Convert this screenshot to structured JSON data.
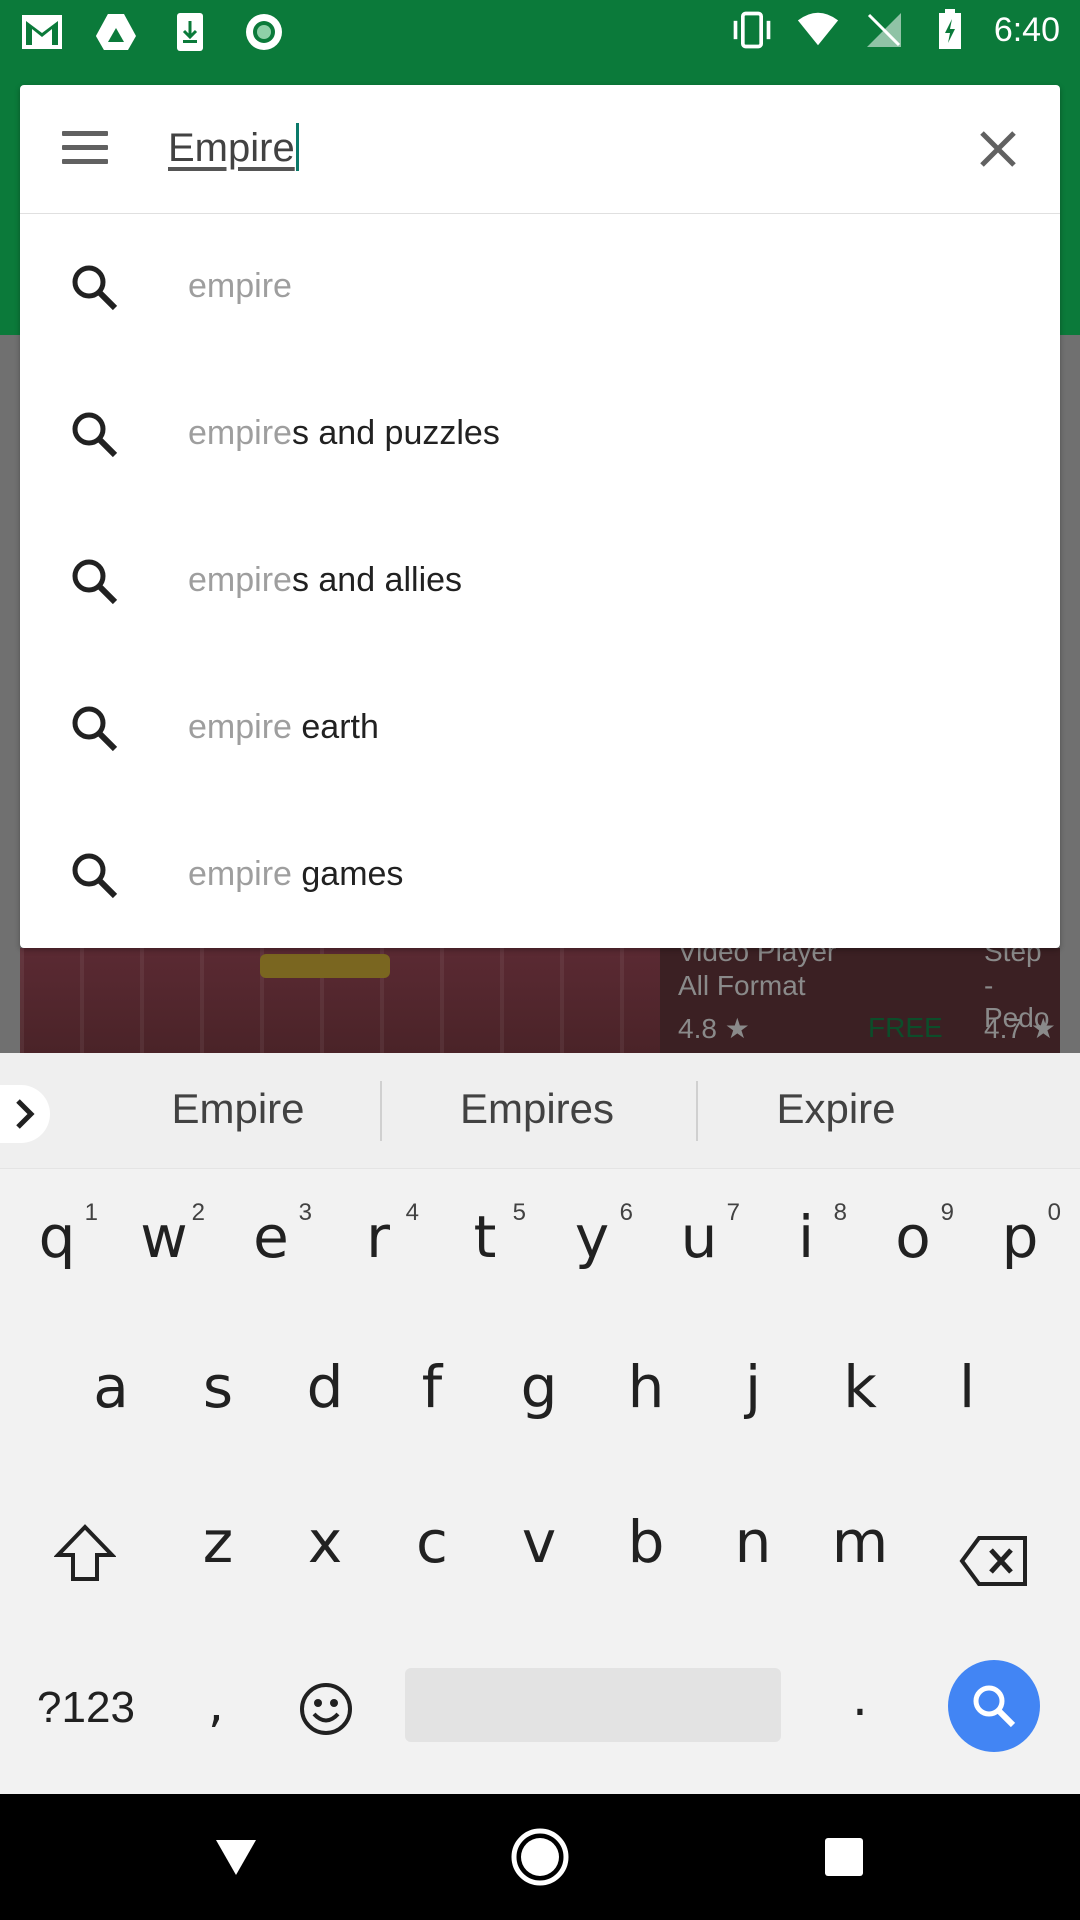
{
  "status_bar": {
    "time": "6:40",
    "left_icons": [
      "gmail-icon",
      "drive-icon",
      "download-icon",
      "record-icon"
    ],
    "right_icons": [
      "vibrate-icon",
      "wifi-icon",
      "no-signal-icon",
      "battery-charging-icon"
    ]
  },
  "search": {
    "query": "Empire",
    "suggestions": [
      {
        "dim": "empire",
        "bold": ""
      },
      {
        "dim": "empire",
        "bold": "s and puzzles"
      },
      {
        "dim": "empire",
        "bold": "s and allies"
      },
      {
        "dim": "empire ",
        "bold": "earth"
      },
      {
        "dim": "empire ",
        "bold": "games"
      }
    ]
  },
  "background_peek": {
    "app1_title_line1": "Video Player",
    "app1_title_line2": "All Format",
    "app1_rating": "4.8 ★",
    "app1_price": "FREE",
    "app2_title_line1": "Step",
    "app2_title_line2": "- Pedo",
    "app2_rating": "4.7 ★"
  },
  "keyboard": {
    "strip_words": [
      "Empire",
      "Empires",
      "Expire"
    ],
    "row1": [
      {
        "k": "q",
        "n": "1"
      },
      {
        "k": "w",
        "n": "2"
      },
      {
        "k": "e",
        "n": "3"
      },
      {
        "k": "r",
        "n": "4"
      },
      {
        "k": "t",
        "n": "5"
      },
      {
        "k": "y",
        "n": "6"
      },
      {
        "k": "u",
        "n": "7"
      },
      {
        "k": "i",
        "n": "8"
      },
      {
        "k": "o",
        "n": "9"
      },
      {
        "k": "p",
        "n": "0"
      }
    ],
    "row2": [
      "a",
      "s",
      "d",
      "f",
      "g",
      "h",
      "j",
      "k",
      "l"
    ],
    "row3": [
      "z",
      "x",
      "c",
      "v",
      "b",
      "n",
      "m"
    ],
    "symbols_label": "?123",
    "comma_label": ",",
    "period_label": "."
  },
  "colors": {
    "accent_green": "#0b7a3a",
    "search_key_blue": "#4285f4",
    "caret": "#0b7a6a"
  }
}
